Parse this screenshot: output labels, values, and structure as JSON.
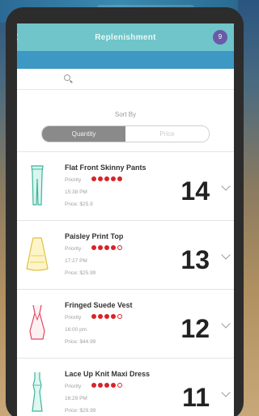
{
  "header": {
    "title": "Replenishment",
    "back_icon": "chevron-left-icon",
    "badge": "9"
  },
  "search": {
    "placeholder": ""
  },
  "sort": {
    "label": "Sort By",
    "options": [
      "Quantity",
      "Price"
    ],
    "selected": "Quantity"
  },
  "items": [
    {
      "name": "Flat Front Skinny Pants",
      "priority_label": "Priority",
      "priority": 5,
      "time": "15:38 PM",
      "price": "Price: $25.9",
      "quantity": "14",
      "icon": "pants-icon"
    },
    {
      "name": "Paisley Print Top",
      "priority_label": "Priority",
      "priority": 4,
      "time": "17:27 PM",
      "price": "Price: $25.99",
      "quantity": "13",
      "icon": "top-icon"
    },
    {
      "name": "Fringed Suede Vest",
      "priority_label": "Priority",
      "priority": 4,
      "time": "16:00 pm",
      "price": "Price: $44.99",
      "quantity": "12",
      "icon": "vest-icon"
    },
    {
      "name": "Lace Up Knit Maxi Dress",
      "priority_label": "Priority",
      "priority": 4,
      "time": "16:29 PM",
      "price": "Price: $29.99",
      "quantity": "11",
      "icon": "dress-icon"
    }
  ],
  "colors": {
    "header": "#6fc5c9",
    "search_strip": "#3d98c4",
    "priority": "#d8232a"
  }
}
